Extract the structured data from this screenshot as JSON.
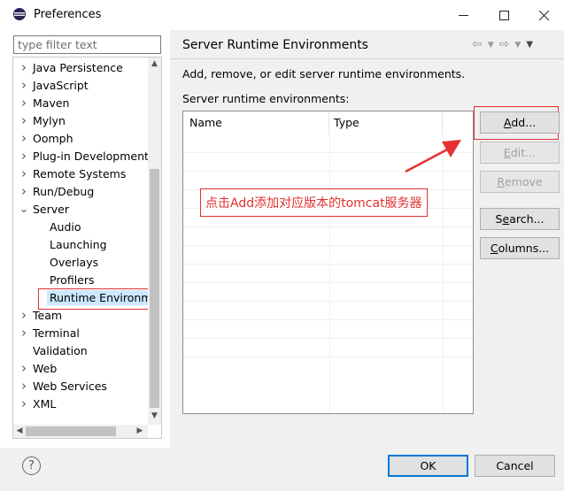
{
  "window": {
    "title": "Preferences",
    "icons": {
      "app": "eclipse-icon",
      "minimize": "minimize-icon",
      "maximize": "maximize-icon",
      "close": "close-icon"
    }
  },
  "filter": {
    "placeholder": "type filter text"
  },
  "tree": {
    "items": [
      {
        "label": "Java Persistence",
        "level": 0,
        "expand": "right"
      },
      {
        "label": "JavaScript",
        "level": 0,
        "expand": "right"
      },
      {
        "label": "Maven",
        "level": 0,
        "expand": "right"
      },
      {
        "label": "Mylyn",
        "level": 0,
        "expand": "right"
      },
      {
        "label": "Oomph",
        "level": 0,
        "expand": "right"
      },
      {
        "label": "Plug-in Development",
        "level": 0,
        "expand": "right"
      },
      {
        "label": "Remote Systems",
        "level": 0,
        "expand": "right"
      },
      {
        "label": "Run/Debug",
        "level": 0,
        "expand": "right"
      },
      {
        "label": "Server",
        "level": 0,
        "expand": "down"
      },
      {
        "label": "Audio",
        "level": 1,
        "expand": ""
      },
      {
        "label": "Launching",
        "level": 1,
        "expand": ""
      },
      {
        "label": "Overlays",
        "level": 1,
        "expand": ""
      },
      {
        "label": "Profilers",
        "level": 1,
        "expand": ""
      },
      {
        "label": "Runtime Environm",
        "level": 1,
        "expand": "",
        "selected": true
      },
      {
        "label": "Team",
        "level": 0,
        "expand": "right"
      },
      {
        "label": "Terminal",
        "level": 0,
        "expand": "right"
      },
      {
        "label": "Validation",
        "level": 0,
        "expand": ""
      },
      {
        "label": "Web",
        "level": 0,
        "expand": "right"
      },
      {
        "label": "Web Services",
        "level": 0,
        "expand": "right"
      },
      {
        "label": "XML",
        "level": 0,
        "expand": "right"
      }
    ]
  },
  "page": {
    "title": "Server Runtime Environments",
    "description": "Add, remove, or edit server runtime environments.",
    "list_label": "Server runtime environments:",
    "columns": [
      "Name",
      "Type"
    ],
    "nav_icons": [
      "back-icon",
      "dropdown-icon",
      "forward-icon",
      "dropdown-icon",
      "menu-icon"
    ]
  },
  "buttons": {
    "add": "Add...",
    "edit": "Edit...",
    "remove": "Remove",
    "search": "Search...",
    "columns": "Columns...",
    "ok": "OK",
    "cancel": "Cancel"
  },
  "annotation": {
    "text": "点击Add添加对应版本的tomcat服务器",
    "color": "#e03030"
  },
  "colors": {
    "accent": "#0078d7",
    "highlight": "#e03030",
    "selection": "#cce8ff"
  }
}
